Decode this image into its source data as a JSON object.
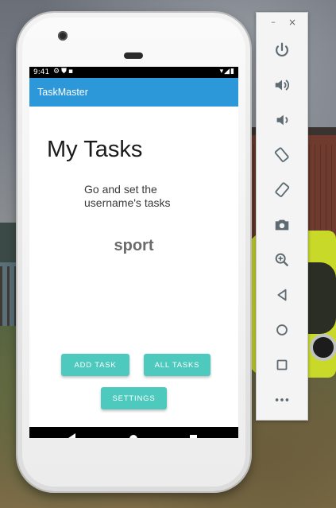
{
  "status_bar": {
    "time": "9:41"
  },
  "app": {
    "title": "TaskMaster",
    "page_title": "My Tasks",
    "instruction_line1": "Go and set the",
    "instruction_line2": "username's tasks",
    "username": "sport",
    "buttons": {
      "add_task": "ADD TASK",
      "all_tasks": "ALL TASKS",
      "settings": "SETTINGS"
    },
    "accent_color": "#2c98d9",
    "button_color": "#4dc9be"
  },
  "emulator_toolbar": {
    "minimize_glyph": "–",
    "close_glyph": "×",
    "icons": [
      "power-icon",
      "volume-up-icon",
      "volume-down-icon",
      "rotate-left-icon",
      "rotate-right-icon",
      "camera-icon",
      "zoom-icon",
      "back-icon",
      "home-icon",
      "overview-icon",
      "more-icon"
    ]
  }
}
